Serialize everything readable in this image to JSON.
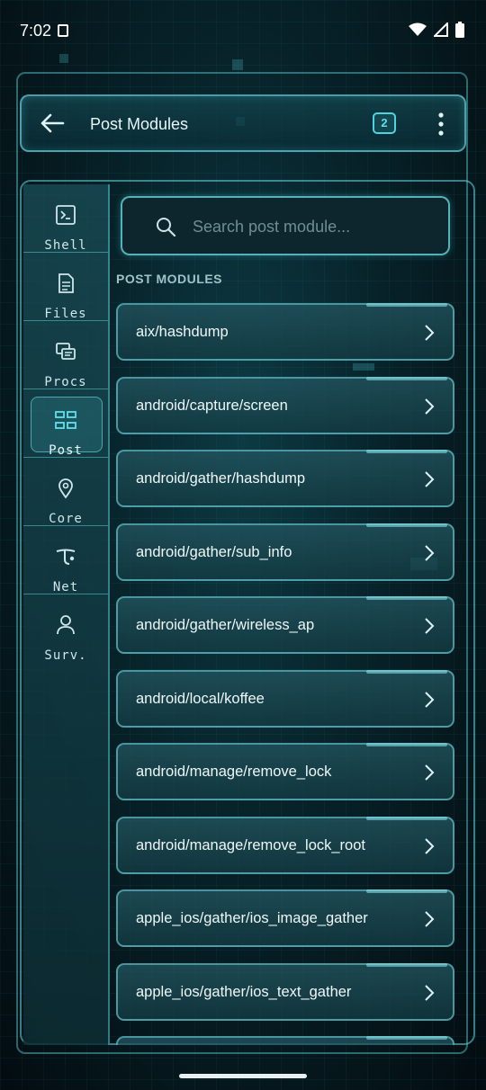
{
  "status_bar": {
    "time": "7:02"
  },
  "header": {
    "title": "Post Modules",
    "badge": "2"
  },
  "sidebar": {
    "items": [
      {
        "label": "Shell",
        "icon": "terminal-icon"
      },
      {
        "label": "Files",
        "icon": "file-icon"
      },
      {
        "label": "Procs",
        "icon": "processes-icon"
      },
      {
        "label": "Post",
        "icon": "grid-modules-icon",
        "active": true
      },
      {
        "label": "Core",
        "icon": "location-pin-icon"
      },
      {
        "label": "Net",
        "icon": "network-icon"
      },
      {
        "label": "Surv.",
        "icon": "person-icon"
      }
    ]
  },
  "search": {
    "placeholder": "Search post module..."
  },
  "section": {
    "label": "POST MODULES"
  },
  "modules": [
    "aix/hashdump",
    "android/capture/screen",
    "android/gather/hashdump",
    "android/gather/sub_info",
    "android/gather/wireless_ap",
    "android/local/koffee",
    "android/manage/remove_lock",
    "android/manage/remove_lock_root",
    "apple_ios/gather/ios_image_gather",
    "apple_ios/gather/ios_text_gather"
  ],
  "colors": {
    "accent": "#4fd3dd",
    "background": "#072128",
    "panel": "#1c4f58"
  }
}
